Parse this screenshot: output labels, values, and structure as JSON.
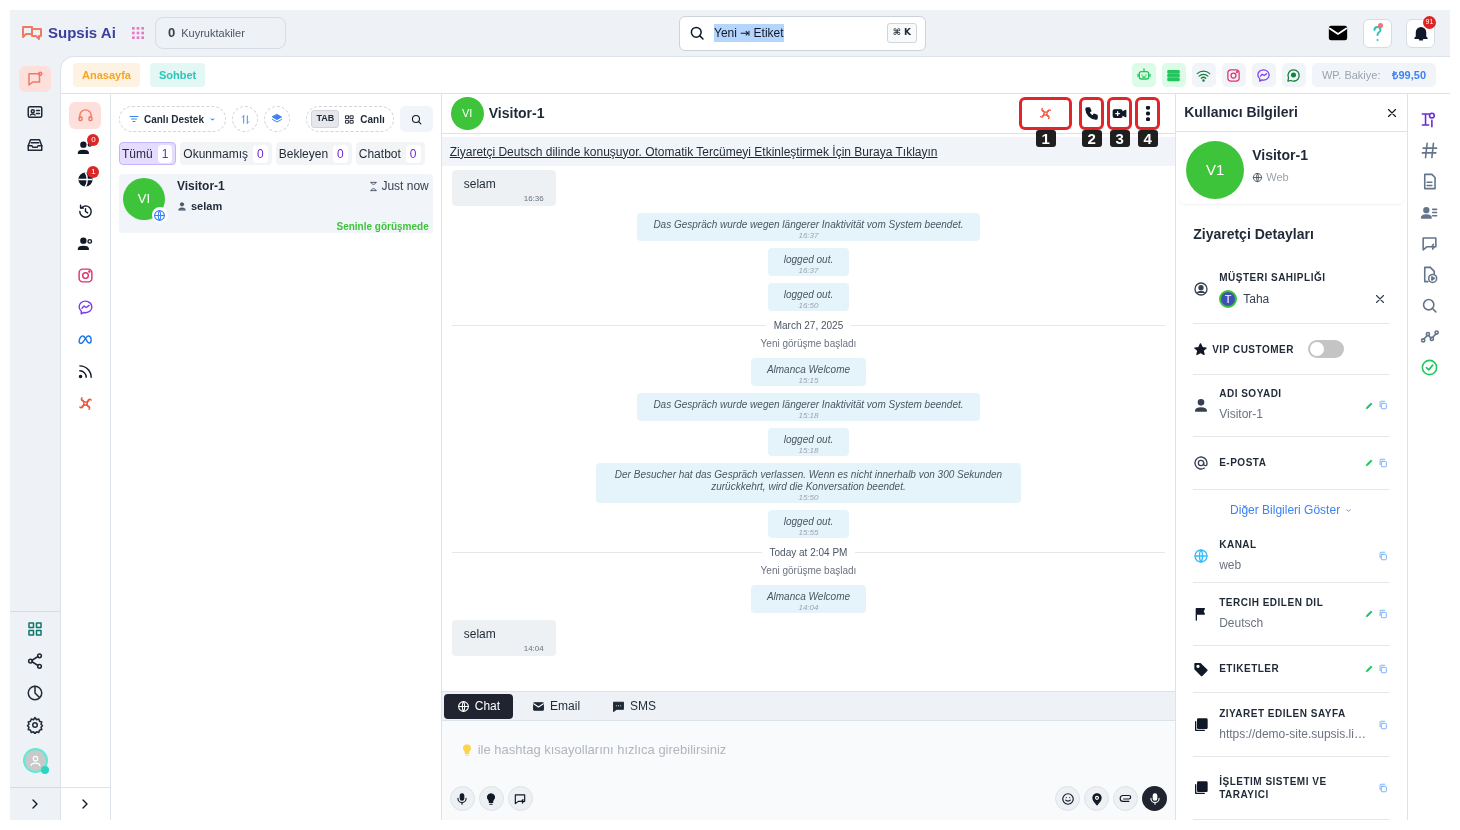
{
  "top_bar": {
    "brand": "Supsis Ai",
    "queue_count": "0",
    "queue_label": "Kuyruktakiler",
    "search_value": "Yeni ⇥ Etiket",
    "search_shortcut": "⌘ K",
    "notification_count": "91"
  },
  "main_rail": [
    {
      "selected": true
    },
    {
      "selected": false
    },
    {
      "selected": false
    }
  ],
  "page_tabs": [
    {
      "label": "Anasayfa",
      "color": "#f5a524"
    },
    {
      "label": "Sohbet",
      "color": "#2cc4b6"
    }
  ],
  "balance": {
    "label": "WP. Bakiye:",
    "value": "₺99,50"
  },
  "channel_rail": [
    {
      "selected": true
    },
    {
      "selected": false,
      "badge": "0"
    },
    {
      "selected": false,
      "badge": "1"
    },
    {
      "selected": false
    },
    {
      "selected": false
    },
    {
      "selected": false
    },
    {
      "selected": false
    },
    {
      "selected": false
    },
    {
      "selected": false
    },
    {
      "selected": false
    }
  ],
  "list": {
    "filter": "Canlı Destek",
    "tab_key": "TAB",
    "mode": "Canlı",
    "tabs": [
      {
        "label": "Tümü",
        "count": "1",
        "selected": true
      },
      {
        "label": "Okunmamış",
        "count": "0",
        "selected": false
      },
      {
        "label": "Bekleyen",
        "count": "0",
        "selected": false
      },
      {
        "label": "Chatbot",
        "count": "0",
        "selected": false
      }
    ],
    "conversations": [
      {
        "avatar": "VI",
        "name": "Visitor-1",
        "time": "Just now",
        "last_message": "selam",
        "status": "Seninle görüşmede",
        "selected": true
      }
    ]
  },
  "chat": {
    "avatar": "VI",
    "name": "Visitor-1",
    "actions": [
      {
        "marker": "1"
      },
      {
        "marker": "2"
      },
      {
        "marker": "3"
      },
      {
        "marker": "4"
      }
    ],
    "banner": "Ziyaretçi Deutsch dilinde konuşuyor. Otomatik Tercümeyi Etkinleştirmek İçin Buraya Tıklayın",
    "messages": [
      {
        "kind": "incoming",
        "text": "selam",
        "time": "16:36"
      },
      {
        "kind": "system",
        "text": "Das Gespräch wurde wegen längerer Inaktivität vom System beendet.",
        "time": "16:37"
      },
      {
        "kind": "system",
        "text": "logged out.",
        "time": "16:37"
      },
      {
        "kind": "system",
        "text": "logged out.",
        "time": "16:50"
      },
      {
        "kind": "divider",
        "text": "March 27, 2025"
      },
      {
        "kind": "note",
        "text": "Yeni görüşme başladı"
      },
      {
        "kind": "system",
        "text": "Almanca Welcome",
        "time": "15:15"
      },
      {
        "kind": "system",
        "text": "Das Gespräch wurde wegen längerer Inaktivität vom System beendet.",
        "time": "15:18"
      },
      {
        "kind": "system",
        "text": "logged out.",
        "time": "15:18"
      },
      {
        "kind": "system",
        "text": "Der Besucher hat das Gespräch verlassen. Wenn es nicht innerhalb von 300 Sekunden zurückkehrt, wird die Konversation beendet.",
        "time": "15:50"
      },
      {
        "kind": "system",
        "text": "logged out.",
        "time": "15:55"
      },
      {
        "kind": "divider",
        "text": "Today at 2:04 PM"
      },
      {
        "kind": "note",
        "text": "Yeni görüşme başladı"
      },
      {
        "kind": "system",
        "text": "Almanca Welcome",
        "time": "14:04"
      },
      {
        "kind": "incoming",
        "text": "selam",
        "time": "14:04"
      }
    ],
    "composer_tabs": [
      {
        "label": "Chat",
        "selected": true
      },
      {
        "label": "Email",
        "selected": false
      },
      {
        "label": "SMS",
        "selected": false
      }
    ],
    "placeholder": "ile hashtag kısayollarını hızlıca girebilirsiniz"
  },
  "info": {
    "title": "Kullanıcı Bilgileri",
    "avatar": "V1",
    "name": "Visitor-1",
    "channel": "Web",
    "section": "Ziyaretçi Detayları",
    "owner": {
      "label": "MÜŞTERI SAHIPLIĞI",
      "initial": "T",
      "name": "Taha"
    },
    "vip": {
      "label": "VIP CUSTOMER",
      "on": false
    },
    "fields": [
      {
        "label": "ADI SOYADI",
        "value": "Visitor-1",
        "editable": true
      },
      {
        "label": "E-POSTA",
        "editable": true
      }
    ],
    "more_link": "Diğer Bilgileri Göster",
    "more_fields": [
      {
        "label": "KANAL",
        "value": "web",
        "editable": false
      },
      {
        "label": "TERCIH EDILEN DIL",
        "value": "Deutsch",
        "editable": true
      },
      {
        "label": "ETIKETLER",
        "editable": true
      },
      {
        "label": "ZIYARET EDILEN SAYFA",
        "value": "https://demo-site.supsis.li…",
        "editable": false
      },
      {
        "label": "İŞLETIM SISTEMI VE TARAYICI",
        "editable": false
      }
    ]
  }
}
